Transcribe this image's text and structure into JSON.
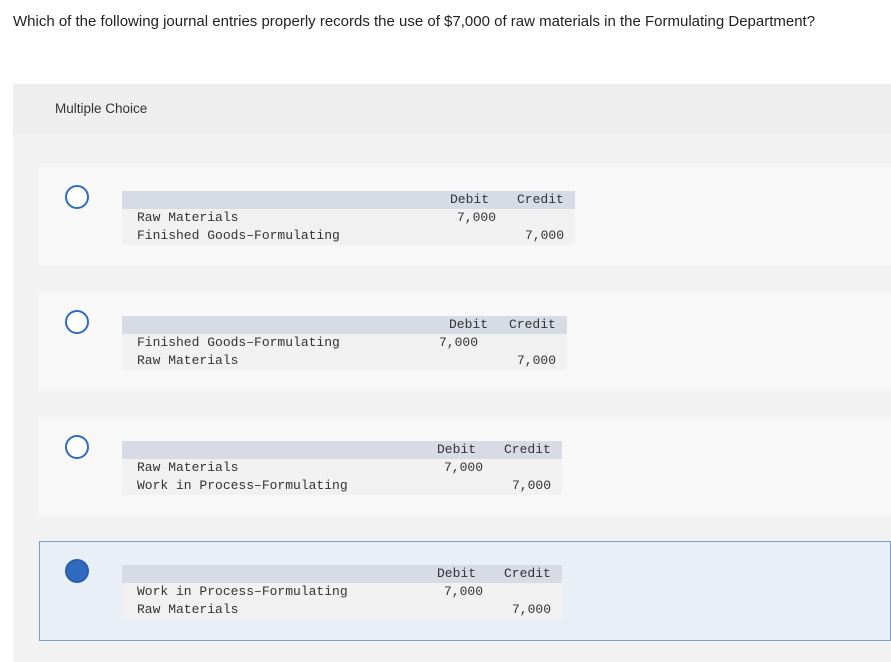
{
  "question": "Which of the following journal entries properly records the use of $7,000 of raw materials in the Formulating Department?",
  "multiple_choice_label": "Multiple Choice",
  "choices": [
    {
      "header": {
        "debit": "Debit",
        "credit": "Credit"
      },
      "rows": [
        {
          "account": "Raw Materials",
          "debit": "7,000",
          "credit": ""
        },
        {
          "account": "Finished Goods–Formulating",
          "debit": "",
          "credit": "7,000"
        }
      ],
      "selected": false
    },
    {
      "header": {
        "debit": "Debit",
        "credit": "Credit"
      },
      "rows": [
        {
          "account": "Finished Goods–Formulating",
          "debit": "7,000",
          "credit": ""
        },
        {
          "account": "Raw Materials",
          "debit": "",
          "credit": "7,000"
        }
      ],
      "selected": false
    },
    {
      "header": {
        "debit": "Debit",
        "credit": "Credit"
      },
      "rows": [
        {
          "account": "Raw Materials",
          "debit": "7,000",
          "credit": ""
        },
        {
          "account": "Work in Process–Formulating",
          "debit": "",
          "credit": "7,000"
        }
      ],
      "selected": false
    },
    {
      "header": {
        "debit": "Debit",
        "credit": "Credit"
      },
      "rows": [
        {
          "account": "Work in Process–Formulating",
          "debit": "7,000",
          "credit": ""
        },
        {
          "account": "Raw Materials",
          "debit": "",
          "credit": "7,000"
        }
      ],
      "selected": true
    }
  ],
  "colors": {
    "radio_border": "#2d6cc0",
    "radio_selected_fill": "#2f6cc1",
    "selected_background": "#e9eff7",
    "table_header": "#d7dbe5"
  }
}
